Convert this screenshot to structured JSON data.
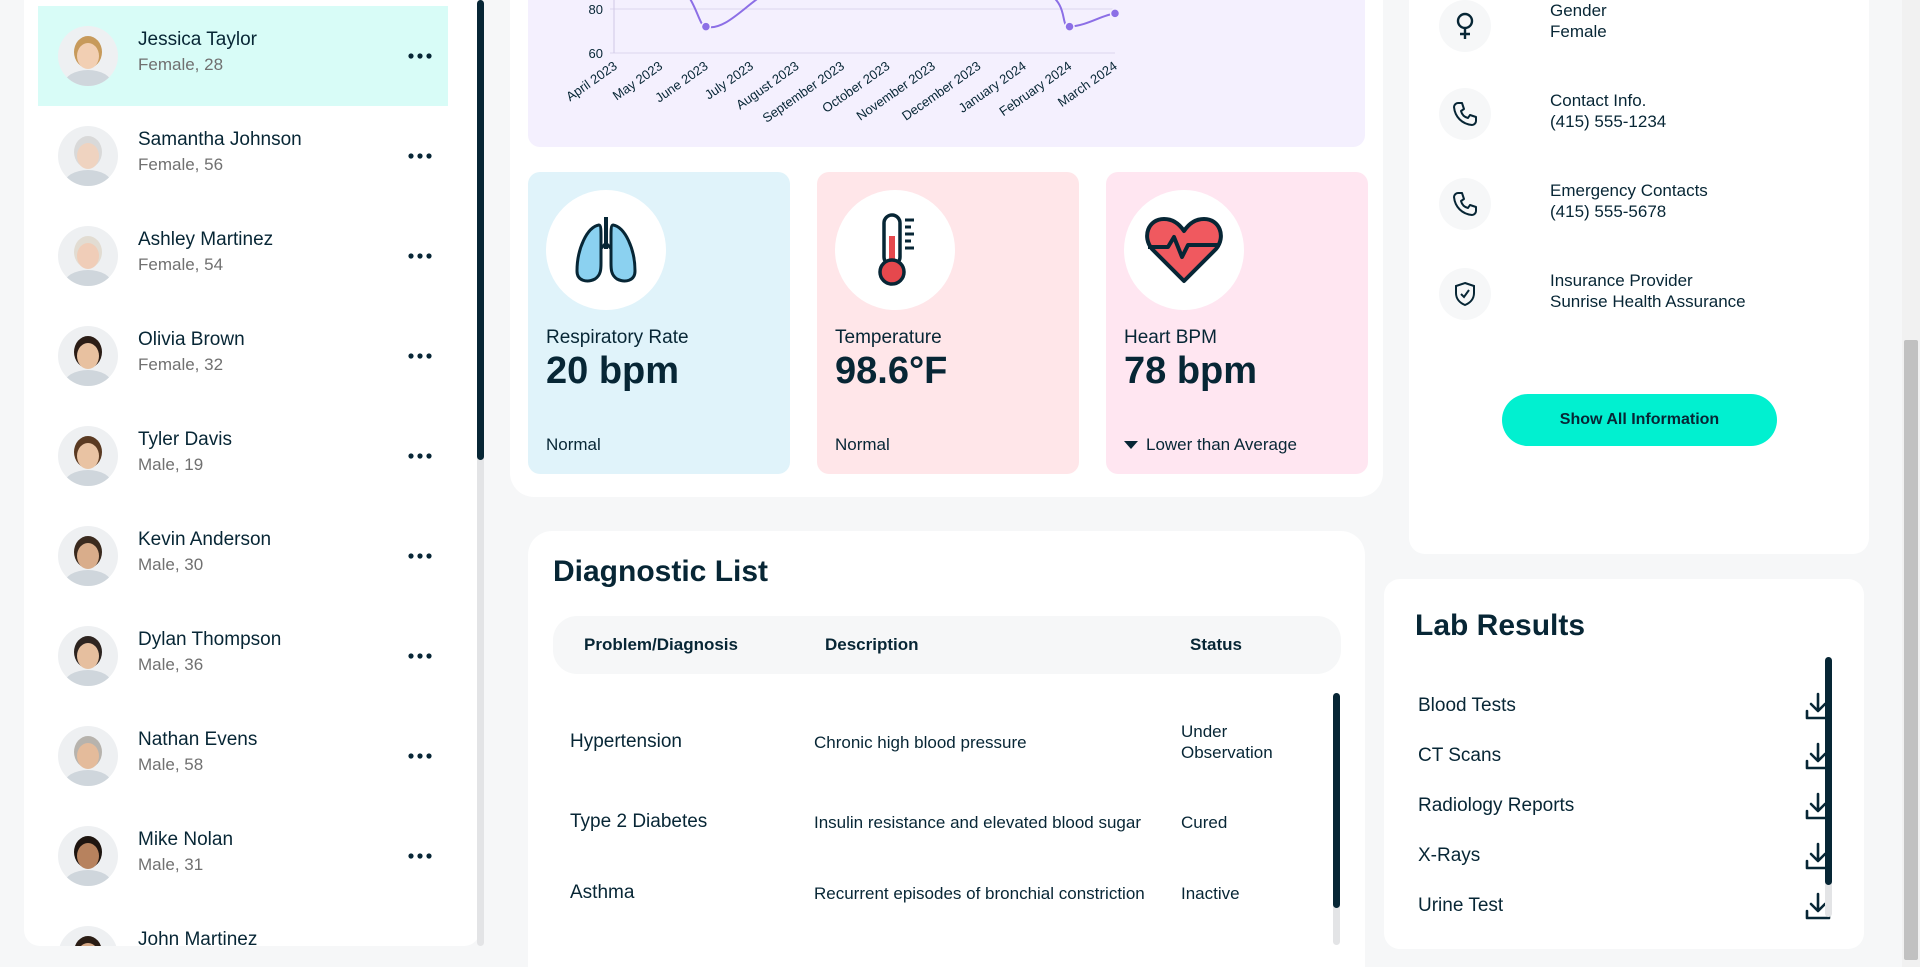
{
  "patients": [
    {
      "name": "Jessica Taylor",
      "meta": "Female, 28",
      "active": true,
      "skin": "#f2cfb3",
      "hair": "#c79a5b"
    },
    {
      "name": "Samantha Johnson",
      "meta": "Female, 56",
      "skin": "#efd3c0",
      "hair": "#d9d9d9"
    },
    {
      "name": "Ashley Martinez",
      "meta": "Female, 54",
      "skin": "#f0cdb8",
      "hair": "#e2dcd2"
    },
    {
      "name": "Olivia Brown",
      "meta": "Female, 32",
      "skin": "#e8c1a0",
      "hair": "#2b1d16"
    },
    {
      "name": "Tyler Davis",
      "meta": "Male, 19",
      "skin": "#e9c3a3",
      "hair": "#5a3a22"
    },
    {
      "name": "Kevin Anderson",
      "meta": "Male, 30",
      "skin": "#d9ad8b",
      "hair": "#3a2a1e"
    },
    {
      "name": "Dylan Thompson",
      "meta": "Male, 36",
      "skin": "#e6bf9f",
      "hair": "#2d2420"
    },
    {
      "name": "Nathan Evens",
      "meta": "Male, 58",
      "skin": "#e4bb9b",
      "hair": "#b7b3ad"
    },
    {
      "name": "Mike Nolan",
      "meta": "Male, 31",
      "skin": "#b7825e",
      "hair": "#1e1510"
    },
    {
      "name": "John Martinez",
      "meta": "",
      "skin": "#d6a987",
      "hair": "#2a1d15"
    }
  ],
  "chart_data": {
    "type": "line",
    "categories": [
      "April 2023",
      "May 2023",
      "June 2023",
      "July 2023",
      "August 2023",
      "September 2023",
      "October 2023",
      "November 2023",
      "December 2023",
      "January 2024",
      "February 2024",
      "March 2024"
    ],
    "ytick_labels": [
      "80",
      "60"
    ],
    "visible_points": [
      {
        "x": "June 2023",
        "y": 72
      },
      {
        "x": "February 2024",
        "y": 72
      },
      {
        "x": "March 2024",
        "y": 78
      }
    ],
    "series_color": "#8c6fe6"
  },
  "vitals": [
    {
      "label": "Respiratory Rate",
      "value": "20 bpm",
      "status": "Normal",
      "icon": "lungs-icon",
      "bg": "#e0f3fa"
    },
    {
      "label": "Temperature",
      "value": "98.6°F",
      "status": "Normal",
      "icon": "thermometer-icon",
      "bg": "#ffe6e9"
    },
    {
      "label": "Heart BPM",
      "value": "78 bpm",
      "status": "Lower than Average",
      "icon": "heart-icon",
      "bg": "#ffe6f1"
    }
  ],
  "diagnostic": {
    "title": "Diagnostic List",
    "columns": [
      "Problem/Diagnosis",
      "Description",
      "Status"
    ],
    "rows": [
      {
        "problem": "Hypertension",
        "description": "Chronic high blood pressure",
        "status": "Under Observation"
      },
      {
        "problem": "Type 2 Diabetes",
        "description": "Insulin resistance and elevated blood sugar",
        "status": "Cured"
      },
      {
        "problem": "Asthma",
        "description": "Recurrent episodes of bronchial constriction",
        "status": "Inactive"
      }
    ]
  },
  "profile": {
    "info": [
      {
        "label": "Gender",
        "value": "Female",
        "icon": "female-icon"
      },
      {
        "label": "Contact Info.",
        "value": "(415) 555-1234",
        "icon": "phone-icon"
      },
      {
        "label": "Emergency Contacts",
        "value": "(415) 555-5678",
        "icon": "phone-icon"
      },
      {
        "label": "Insurance Provider",
        "value": "Sunrise Health Assurance",
        "icon": "shield-icon"
      }
    ],
    "show_all_label": "Show All Information"
  },
  "lab_results": {
    "title": "Lab Results",
    "items": [
      "Blood Tests",
      "CT Scans",
      "Radiology Reports",
      "X-Rays",
      "Urine Test"
    ]
  },
  "colors": {
    "accent": "#01f0d0",
    "active_row": "#d8fcf7",
    "text": "#072635",
    "muted": "#707070"
  }
}
